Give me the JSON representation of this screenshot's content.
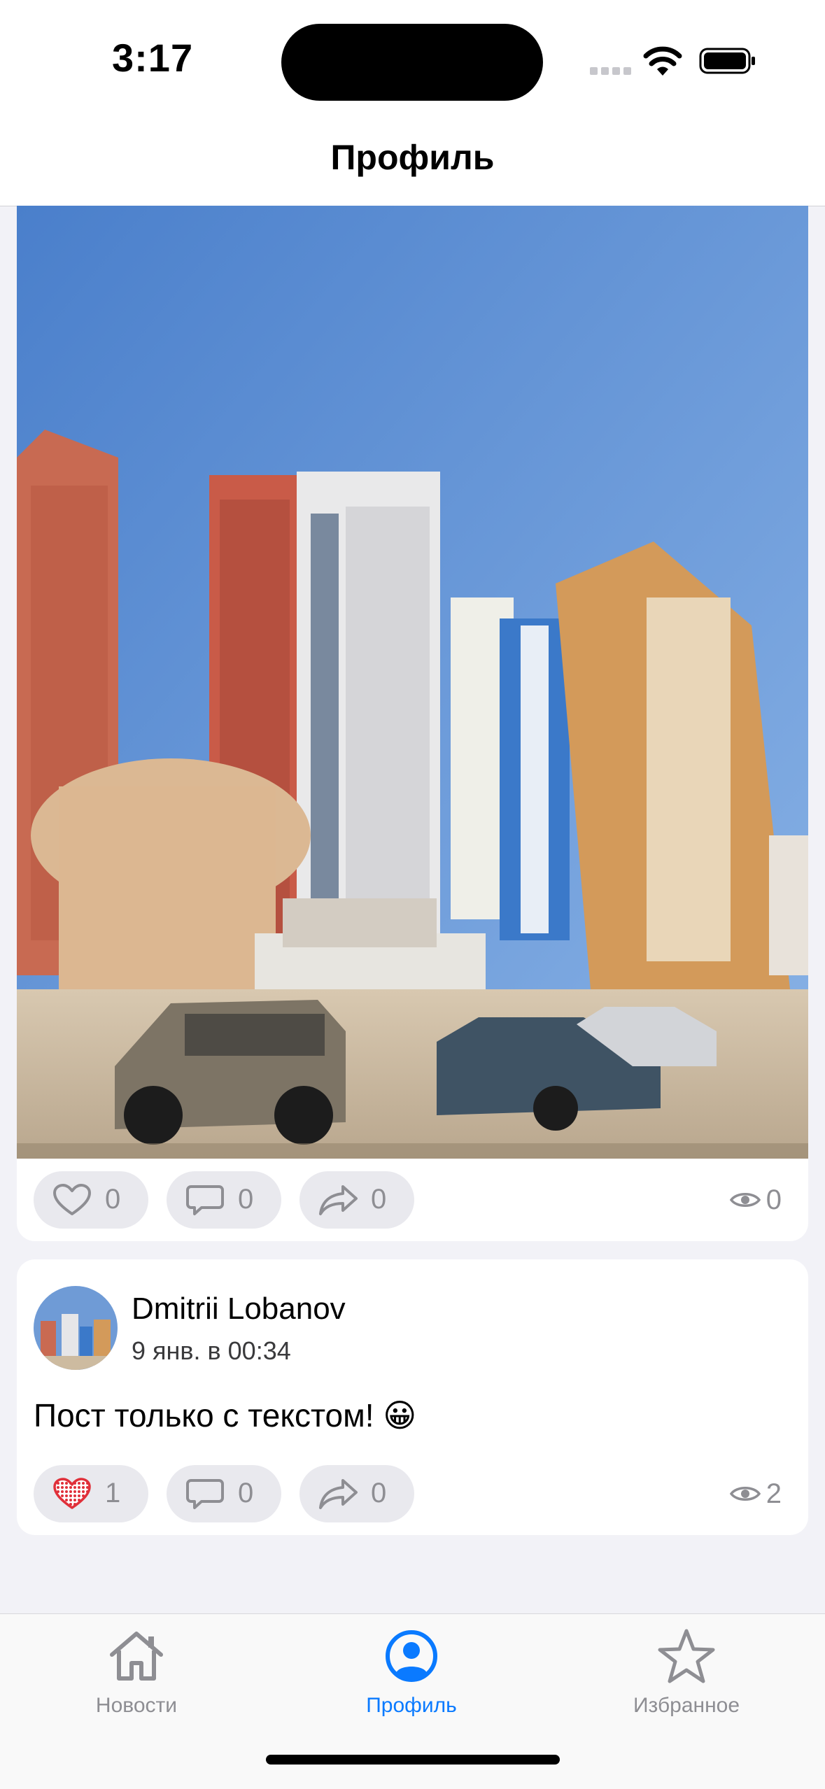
{
  "status_bar": {
    "time": "3:17",
    "icons": [
      "signal-dots-icon",
      "wifi-icon",
      "battery-icon"
    ]
  },
  "nav": {
    "title": "Профиль"
  },
  "colors": {
    "accent": "#0a7aff",
    "like_red": "#e0303a",
    "muted": "#8e8e93"
  },
  "posts": [
    {
      "has_image": true,
      "image_desc": "city-buildings-photo",
      "likes": "0",
      "comments": "0",
      "shares": "0",
      "views": "0",
      "liked": false
    },
    {
      "author": "Dmitrii Lobanov",
      "date": "9 янв. в 00:34",
      "text": "Пост только с текстом! 😀",
      "likes": "1",
      "comments": "0",
      "shares": "0",
      "views": "2",
      "liked": true
    }
  ],
  "tabs": [
    {
      "label": "Новости",
      "icon": "house-icon",
      "active": false
    },
    {
      "label": "Профиль",
      "icon": "person-circle-icon",
      "active": true
    },
    {
      "label": "Избранное",
      "icon": "star-icon",
      "active": false
    }
  ]
}
